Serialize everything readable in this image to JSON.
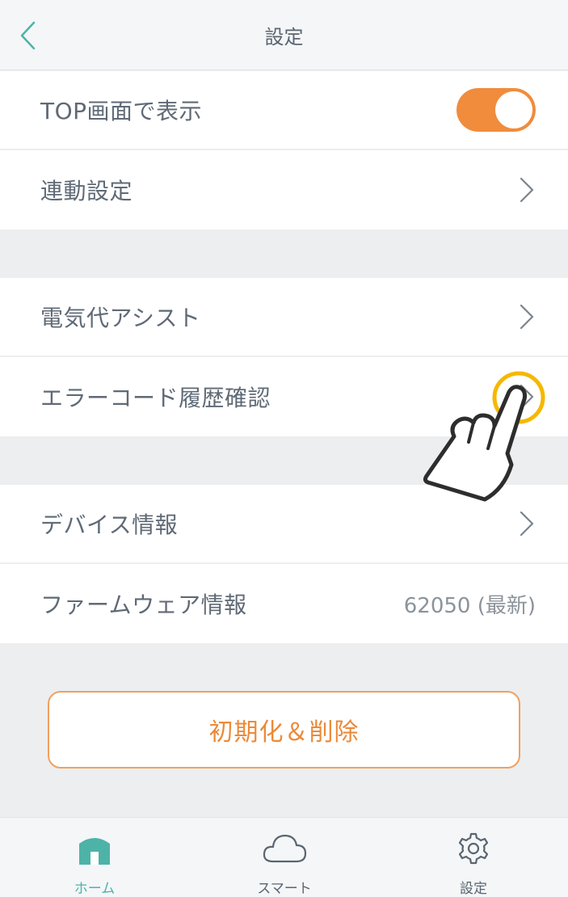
{
  "header": {
    "title": "設定",
    "back_icon": "chevron-left-icon"
  },
  "section1": {
    "items": [
      {
        "label": "TOP画面で表示",
        "type": "toggle",
        "on": true
      },
      {
        "label": "連動設定",
        "type": "link"
      }
    ]
  },
  "section2": {
    "items": [
      {
        "label": "電気代アシスト",
        "type": "link"
      },
      {
        "label": "エラーコード履歴確認",
        "type": "link"
      }
    ]
  },
  "section3": {
    "items": [
      {
        "label": "デバイス情報",
        "type": "link"
      },
      {
        "label": "ファームウェア情報",
        "type": "value",
        "value": "62050 (最新)"
      }
    ]
  },
  "reset_button": {
    "label": "初期化＆削除"
  },
  "tabbar": {
    "tabs": [
      {
        "label": "ホーム",
        "icon": "home-icon",
        "active": true
      },
      {
        "label": "スマート",
        "icon": "cloud-icon",
        "active": false
      },
      {
        "label": "設定",
        "icon": "gear-icon",
        "active": false
      }
    ]
  },
  "colors": {
    "accent_orange": "#f08c3c",
    "accent_teal": "#4db3a8",
    "highlight_yellow": "#f5b800"
  }
}
